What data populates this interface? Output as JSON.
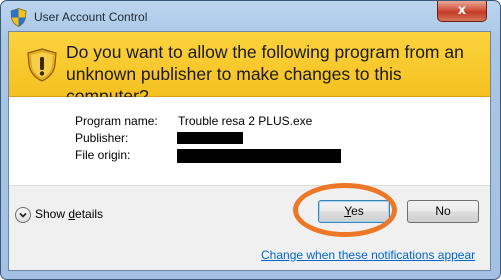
{
  "window": {
    "title": "User Account Control",
    "close_label": "x"
  },
  "banner": {
    "question": "Do you want to allow the following program from an unknown publisher to make changes to this computer?"
  },
  "details": {
    "program_name_label": "Program name:",
    "program_name_value": "Trouble resa 2 PLUS.exe",
    "publisher_label": "Publisher:",
    "file_origin_label": "File origin:"
  },
  "footer": {
    "show_details_prefix": "Show ",
    "show_details_accel": "d",
    "show_details_suffix": "etails",
    "yes_accel": "Y",
    "yes_rest": "es",
    "no_label": "No",
    "change_link": "Change when these notifications appear"
  },
  "colors": {
    "banner_yellow": "#f5c121",
    "highlight_orange": "#ee7627",
    "link_blue": "#0066cc"
  },
  "icons": [
    "uac-shield-icon",
    "warning-shield-icon",
    "chevron-down-icon",
    "close-icon"
  ]
}
